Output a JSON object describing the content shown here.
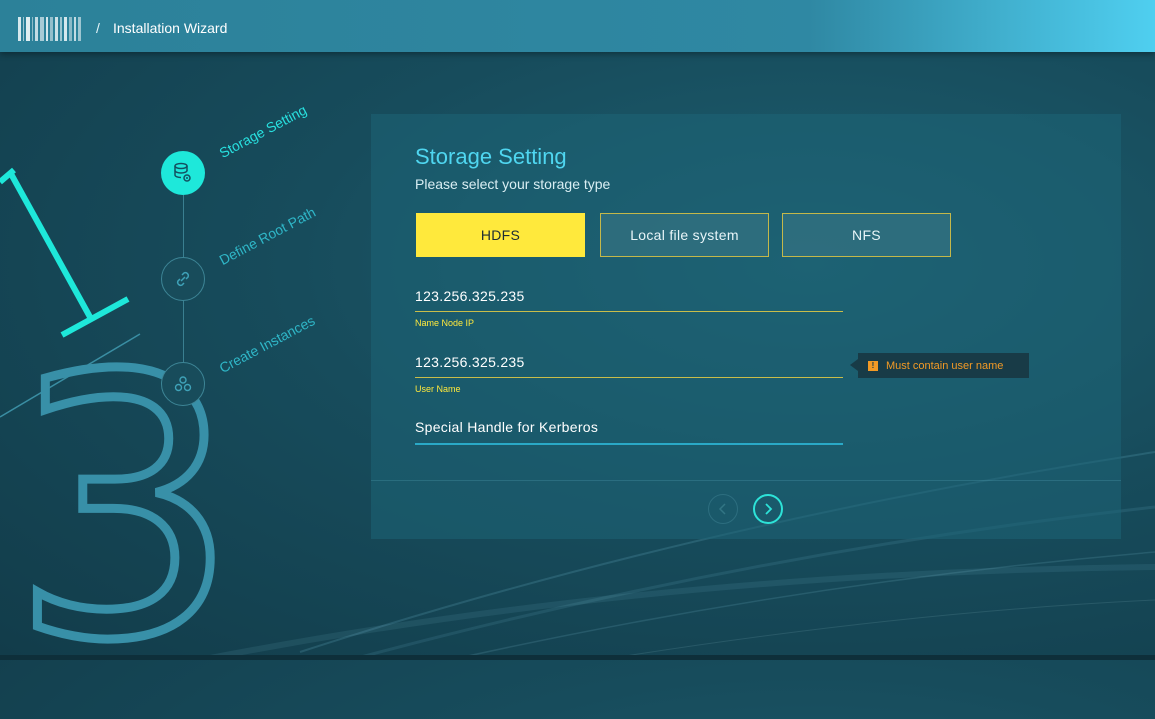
{
  "header": {
    "separator": "/",
    "title": "Installation Wizard"
  },
  "background": {
    "step_number": "3"
  },
  "steps": [
    {
      "label": "Storage Setting",
      "icon": "database-gear-icon",
      "active": true
    },
    {
      "label": "Define Root Path",
      "icon": "link-icon",
      "active": false
    },
    {
      "label": "Create Instances",
      "icon": "nodes-icon",
      "active": false
    }
  ],
  "panel": {
    "title": "Storage Setting",
    "subtitle": "Please select your storage type",
    "options": [
      {
        "label": "HDFS",
        "selected": true
      },
      {
        "label": "Local file system",
        "selected": false
      },
      {
        "label": "NFS",
        "selected": false
      }
    ],
    "fields": [
      {
        "value": "123.256.325.235",
        "label": "Name Node IP"
      },
      {
        "value": "123.256.325.235",
        "label": "User Name"
      },
      {
        "value": "Special Handle for Kerberos",
        "label": ""
      }
    ],
    "tooltip": {
      "icon": "warning-icon",
      "glyph": "!",
      "text": "Must contain user name"
    }
  },
  "colors": {
    "accent": "#1ee8da",
    "selected": "#ffe93c",
    "warning": "#f29a25",
    "title": "#4fd6f0"
  }
}
